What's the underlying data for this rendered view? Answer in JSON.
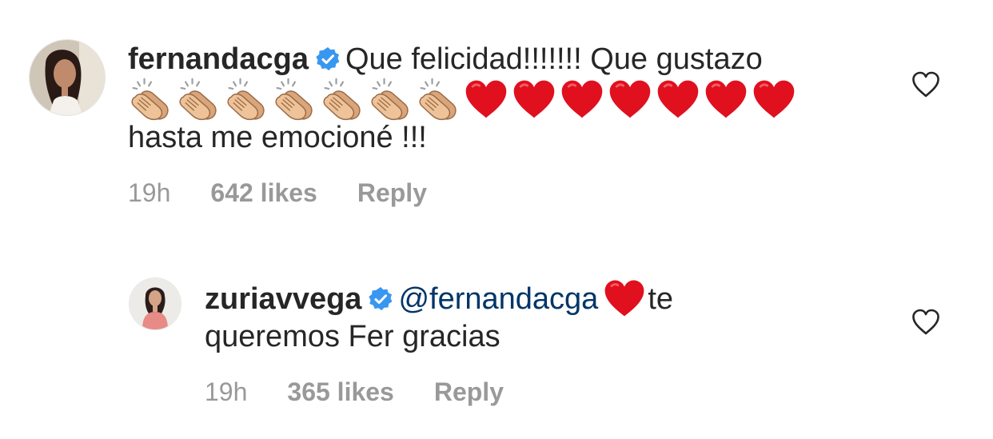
{
  "comments": [
    {
      "username": "fernandacga",
      "verified": true,
      "text_line1": "Que felicidad!!!!!!! Que gustazo",
      "emoji_row": {
        "clapping_hands_count": 7,
        "red_hearts_count": 7
      },
      "text_line3": "hasta me emocioné !!!",
      "time": "19h",
      "likes": "642 likes",
      "reply_label": "Reply",
      "like_icon": "heart-outline-icon"
    },
    {
      "username": "zuriavvega",
      "verified": true,
      "mention": "@fernandacga",
      "text_after_heart": "te",
      "text_line2": "queremos Fer gracias",
      "time": "19h",
      "likes": "365 likes",
      "reply_label": "Reply",
      "like_icon": "heart-outline-icon"
    }
  ],
  "colors": {
    "text": "#262626",
    "meta": "#999999",
    "mention": "#003569",
    "verified_badge": "#3897f0",
    "heart_emoji": "#e0101f",
    "clap_skin": "#e8bb8d"
  }
}
